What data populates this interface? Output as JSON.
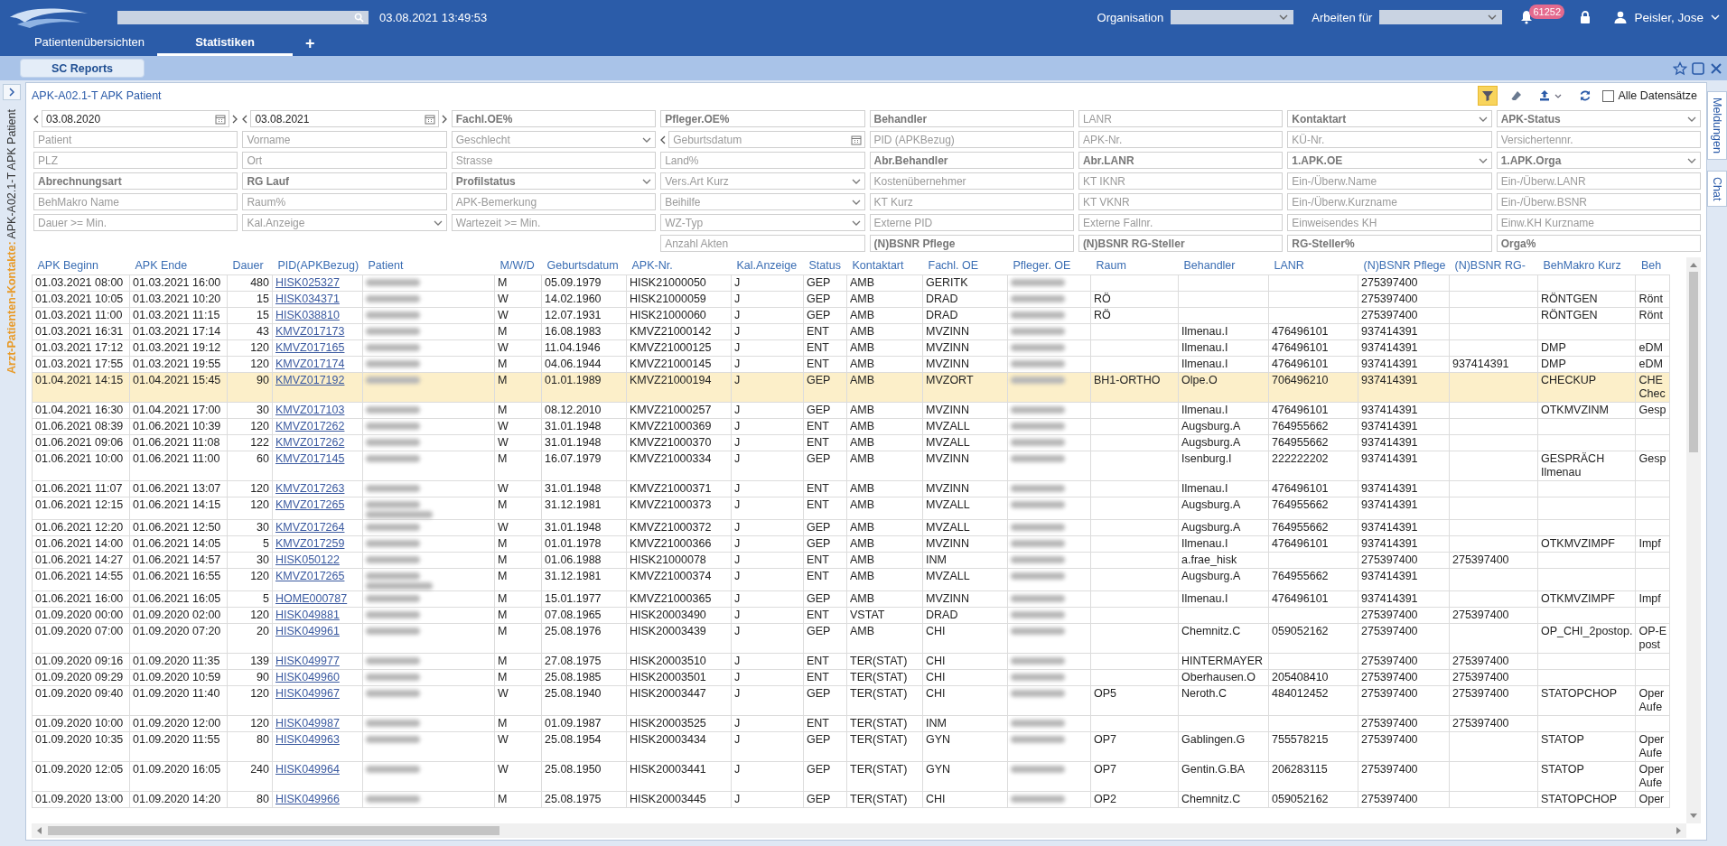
{
  "header": {
    "datetime": "03.08.2021 13:49:53",
    "organisation_label": "Organisation",
    "work_for_label": "Arbeiten für",
    "notification_count": "61252",
    "user": "Peisler, Jose"
  },
  "tabs": [
    {
      "label": "Patientenübersichten",
      "selected": false
    },
    {
      "label": "Statistiken",
      "selected": true
    }
  ],
  "add_tab": "+",
  "subbar": {
    "button": "SC Reports"
  },
  "side_label": "**Arzt-Patienten-Kontakte:** APK-A02.1-T APK Patient",
  "right_tabs": [
    "Meldungen",
    "Chat"
  ],
  "report": {
    "title": "APK-A02.1-T APK Patient",
    "toolbar": [
      {
        "kind": "filter",
        "selected": true
      },
      {
        "kind": "eraser",
        "selected": false
      },
      {
        "kind": "export",
        "selected": false
      },
      {
        "kind": "refresh",
        "selected": false
      }
    ],
    "all_records": {
      "label": "Alle Datensätze",
      "checked": false
    }
  },
  "filters": [
    [
      {
        "kind": "date",
        "value": "03.08.2020"
      },
      {
        "kind": "date",
        "value": "03.08.2021"
      },
      {
        "kind": "text",
        "placeholder": "Fachl.OE%",
        "strong": true
      },
      {
        "kind": "text",
        "placeholder": "Pfleger.OE%",
        "strong": true
      },
      {
        "kind": "text",
        "placeholder": "Behandler",
        "strong": true
      },
      {
        "kind": "text",
        "placeholder": "LANR",
        "strong": false
      },
      {
        "kind": "select",
        "placeholder": "Kontaktart",
        "strong": true
      },
      {
        "kind": "select",
        "placeholder": "APK-Status",
        "strong": true
      }
    ],
    [
      {
        "kind": "text",
        "placeholder": "Patient",
        "strong": false
      },
      {
        "kind": "text",
        "placeholder": "Vorname",
        "strong": false
      },
      {
        "kind": "select",
        "placeholder": "Geschlecht",
        "strong": false
      },
      {
        "kind": "date",
        "placeholder": "Geburtsdatum"
      },
      {
        "kind": "text",
        "placeholder": "PID (APKBezug)",
        "strong": false
      },
      {
        "kind": "text",
        "placeholder": "APK-Nr.",
        "strong": false
      },
      {
        "kind": "text",
        "placeholder": "KÜ-Nr.",
        "strong": false
      },
      {
        "kind": "text",
        "placeholder": "Versichertennr.",
        "strong": false
      }
    ],
    [
      {
        "kind": "text",
        "placeholder": "PLZ",
        "strong": false
      },
      {
        "kind": "text",
        "placeholder": "Ort",
        "strong": false
      },
      {
        "kind": "text",
        "placeholder": "Strasse",
        "strong": false
      },
      {
        "kind": "text",
        "placeholder": "Land%",
        "strong": false
      },
      {
        "kind": "text",
        "placeholder": "Abr.Behandler",
        "strong": true
      },
      {
        "kind": "text",
        "placeholder": "Abr.LANR",
        "strong": true
      },
      {
        "kind": "select",
        "placeholder": "1.APK.OE",
        "strong": true
      },
      {
        "kind": "select",
        "placeholder": "1.APK.Orga",
        "strong": true
      }
    ],
    [
      {
        "kind": "text",
        "placeholder": "Abrechnungsart",
        "strong": true
      },
      {
        "kind": "text",
        "placeholder": "RG Lauf",
        "strong": true
      },
      {
        "kind": "select",
        "placeholder": "Profilstatus",
        "strong": true
      },
      {
        "kind": "select",
        "placeholder": "Vers.Art Kurz",
        "strong": false
      },
      {
        "kind": "text",
        "placeholder": "Kostenübernehmer",
        "strong": false
      },
      {
        "kind": "text",
        "placeholder": "KT IKNR",
        "strong": false
      },
      {
        "kind": "text",
        "placeholder": "Ein-/Überw.Name",
        "strong": false
      },
      {
        "kind": "text",
        "placeholder": "Ein-/Überw.LANR",
        "strong": false
      }
    ],
    [
      {
        "kind": "text",
        "placeholder": "BehMakro Name",
        "strong": false
      },
      {
        "kind": "text",
        "placeholder": "Raum%",
        "strong": false
      },
      {
        "kind": "text",
        "placeholder": "APK-Bemerkung",
        "strong": false
      },
      {
        "kind": "select",
        "placeholder": "Beihilfe",
        "strong": false
      },
      {
        "kind": "text",
        "placeholder": "KT Kurz",
        "strong": false
      },
      {
        "kind": "text",
        "placeholder": "KT VKNR",
        "strong": false
      },
      {
        "kind": "text",
        "placeholder": "Ein-/Überw.Kurzname",
        "strong": false
      },
      {
        "kind": "text",
        "placeholder": "Ein-/Überw.BSNR",
        "strong": false
      }
    ],
    [
      {
        "kind": "text",
        "placeholder": "Dauer >= Min.",
        "strong": false
      },
      {
        "kind": "select",
        "placeholder": "Kal.Anzeige",
        "strong": false
      },
      {
        "kind": "text",
        "placeholder": "Wartezeit >= Min.",
        "strong": false
      },
      {
        "kind": "select",
        "placeholder": "WZ-Typ",
        "strong": false
      },
      {
        "kind": "text",
        "placeholder": "Externe PID",
        "strong": false
      },
      {
        "kind": "text",
        "placeholder": "Externe Fallnr.",
        "strong": false
      },
      {
        "kind": "text",
        "placeholder": "Einweisendes KH",
        "strong": false
      },
      {
        "kind": "text",
        "placeholder": "Einw.KH Kurzname",
        "strong": false
      }
    ],
    [
      {
        "kind": "text",
        "placeholder": "Anzahl Akten",
        "strong": false
      },
      {
        "kind": "text",
        "placeholder": "(N)BSNR Pflege",
        "strong": true
      },
      {
        "kind": "text",
        "placeholder": "(N)BSNR RG-Steller",
        "strong": true
      },
      {
        "kind": "text",
        "placeholder": "RG-Steller%",
        "strong": true
      },
      {
        "kind": "text",
        "placeholder": "Orga%",
        "strong": true
      }
    ]
  ],
  "table": {
    "columns": [
      {
        "label": "APK Beginn",
        "kind": "text"
      },
      {
        "label": "APK Ende",
        "kind": "text"
      },
      {
        "label": "Dauer",
        "kind": "number"
      },
      {
        "label": "PID(APKBezug)",
        "kind": "link"
      },
      {
        "label": "Patient",
        "kind": "blurred"
      },
      {
        "label": "M/W/D",
        "kind": "text"
      },
      {
        "label": "Geburtsdatum",
        "kind": "text"
      },
      {
        "label": "APK-Nr.",
        "kind": "text"
      },
      {
        "label": "Kal.Anzeige",
        "kind": "text"
      },
      {
        "label": "Status",
        "kind": "text"
      },
      {
        "label": "Kontaktart",
        "kind": "text"
      },
      {
        "label": "Fachl. OE",
        "kind": "text"
      },
      {
        "label": "Pfleger. OE",
        "kind": "blurred"
      },
      {
        "label": "Raum",
        "kind": "text"
      },
      {
        "label": "Behandler",
        "kind": "text"
      },
      {
        "label": "LANR",
        "kind": "text"
      },
      {
        "label": "(N)BSNR Pflege",
        "kind": "text"
      },
      {
        "label": "(N)BSNR RG-",
        "kind": "text"
      },
      {
        "label": "BehMakro Kurz",
        "kind": "text"
      },
      {
        "label": "Beh",
        "kind": "text"
      }
    ],
    "rows": [
      {
        "selected": false,
        "patient_wraps": false,
        "cells": [
          "01.03.2021 08:00",
          "01.03.2021 16:00",
          "480",
          "HISK025327",
          null,
          "M",
          "05.09.1979",
          "HISK21000050",
          "J",
          "GEP",
          "AMB",
          "GERITK",
          null,
          null,
          null,
          null,
          "275397400"
        ]
      },
      {
        "selected": false,
        "patient_wraps": false,
        "cells": [
          "01.03.2021 10:05",
          "01.03.2021 10:20",
          "15",
          "HISK034371",
          null,
          "W",
          "14.02.1960",
          "HISK21000059",
          "J",
          "GEP",
          "AMB",
          "DRAD",
          null,
          "RÖ",
          null,
          null,
          "275397400",
          null,
          "RÖNTGEN",
          "Rönt"
        ]
      },
      {
        "selected": false,
        "patient_wraps": false,
        "cells": [
          "01.03.2021 11:00",
          "01.03.2021 11:15",
          "15",
          "HISK038810",
          null,
          "W",
          "12.07.1931",
          "HISK21000060",
          "J",
          "GEP",
          "AMB",
          "DRAD",
          null,
          "RÖ",
          null,
          null,
          "275397400",
          null,
          "RÖNTGEN",
          "Rönt"
        ]
      },
      {
        "selected": false,
        "patient_wraps": false,
        "cells": [
          "01.03.2021 16:31",
          "01.03.2021 17:14",
          "43",
          "KMVZ017173",
          null,
          "M",
          "16.08.1983",
          "KMVZ21000142",
          "J",
          "ENT",
          "AMB",
          "MVZINN",
          null,
          null,
          "Ilmenau.I",
          "476496101",
          "937414391"
        ]
      },
      {
        "selected": false,
        "patient_wraps": false,
        "cells": [
          "01.03.2021 17:12",
          "01.03.2021 19:12",
          "120",
          "KMVZ017165",
          null,
          "W",
          "11.04.1946",
          "KMVZ21000125",
          "J",
          "ENT",
          "AMB",
          "MVZINN",
          null,
          null,
          "Ilmenau.I",
          "476496101",
          "937414391",
          null,
          "DMP",
          "eDM"
        ]
      },
      {
        "selected": false,
        "patient_wraps": false,
        "cells": [
          "01.03.2021 17:55",
          "01.03.2021 19:55",
          "120",
          "KMVZ017174",
          null,
          "M",
          "04.06.1944",
          "KMVZ21000145",
          "J",
          "ENT",
          "AMB",
          "MVZINN",
          null,
          null,
          "Ilmenau.I",
          "476496101",
          "937414391",
          "937414391",
          "DMP",
          "eDM"
        ]
      },
      {
        "selected": true,
        "patient_wraps": false,
        "cells": [
          "01.04.2021 14:15",
          "01.04.2021 15:45",
          "90",
          "KMVZ017192",
          null,
          "M",
          "01.01.1989",
          "KMVZ21000194",
          "J",
          "GEP",
          "AMB",
          "MVZORT",
          null,
          "BH1-ORTHO",
          "Olpe.O",
          "706496210",
          "937414391",
          null,
          "CHECKUP",
          "CHE\nChec"
        ]
      },
      {
        "selected": false,
        "patient_wraps": false,
        "cells": [
          "01.04.2021 16:30",
          "01.04.2021 17:00",
          "30",
          "KMVZ017103",
          null,
          "M",
          "08.12.2010",
          "KMVZ21000257",
          "J",
          "GEP",
          "AMB",
          "MVZINN",
          null,
          null,
          "Ilmenau.I",
          "476496101",
          "937414391",
          null,
          "OTKMVZINM",
          "Gesp"
        ]
      },
      {
        "selected": false,
        "patient_wraps": false,
        "cells": [
          "01.06.2021 08:39",
          "01.06.2021 10:39",
          "120",
          "KMVZ017262",
          null,
          "W",
          "31.01.1948",
          "KMVZ21000369",
          "J",
          "ENT",
          "AMB",
          "MVZALL",
          null,
          null,
          "Augsburg.A",
          "764955662",
          "937414391"
        ]
      },
      {
        "selected": false,
        "patient_wraps": false,
        "cells": [
          "01.06.2021 09:06",
          "01.06.2021 11:08",
          "122",
          "KMVZ017262",
          null,
          "W",
          "31.01.1948",
          "KMVZ21000370",
          "J",
          "ENT",
          "AMB",
          "MVZALL",
          null,
          null,
          "Augsburg.A",
          "764955662",
          "937414391"
        ]
      },
      {
        "selected": false,
        "patient_wraps": false,
        "cells": [
          "01.06.2021 10:00",
          "01.06.2021 11:00",
          "60",
          "KMVZ017145",
          null,
          "M",
          "16.07.1979",
          "KMVZ21000334",
          "J",
          "GEP",
          "AMB",
          "MVZINN",
          null,
          null,
          "Isenburg.I",
          "222222202",
          "937414391",
          null,
          "GESPRÄCH\nIlmenau",
          "Gesp"
        ]
      },
      {
        "selected": false,
        "patient_wraps": false,
        "cells": [
          "01.06.2021 11:07",
          "01.06.2021 13:07",
          "120",
          "KMVZ017263",
          null,
          "W",
          "31.01.1948",
          "KMVZ21000371",
          "J",
          "ENT",
          "AMB",
          "MVZINN",
          null,
          null,
          "Ilmenau.I",
          "476496101",
          "937414391"
        ]
      },
      {
        "selected": false,
        "patient_wraps": true,
        "cells": [
          "01.06.2021 12:15",
          "01.06.2021 14:15",
          "120",
          "KMVZ017265",
          null,
          "M",
          "31.12.1981",
          "KMVZ21000373",
          "J",
          "ENT",
          "AMB",
          "MVZALL",
          null,
          null,
          "Augsburg.A",
          "764955662",
          "937414391"
        ]
      },
      {
        "selected": false,
        "patient_wraps": false,
        "cells": [
          "01.06.2021 12:20",
          "01.06.2021 12:50",
          "30",
          "KMVZ017264",
          null,
          "W",
          "31.01.1948",
          "KMVZ21000372",
          "J",
          "GEP",
          "AMB",
          "MVZALL",
          null,
          null,
          "Augsburg.A",
          "764955662",
          "937414391"
        ]
      },
      {
        "selected": false,
        "patient_wraps": false,
        "cells": [
          "01.06.2021 14:00",
          "01.06.2021 14:05",
          "5",
          "KMVZ017259",
          null,
          "M",
          "01.01.1978",
          "KMVZ21000366",
          "J",
          "GEP",
          "AMB",
          "MVZINN",
          null,
          null,
          "Ilmenau.I",
          "476496101",
          "937414391",
          null,
          "OTKMVZIMPF",
          "Impf"
        ]
      },
      {
        "selected": false,
        "patient_wraps": false,
        "cells": [
          "01.06.2021 14:27",
          "01.06.2021 14:57",
          "30",
          "HISK050122",
          null,
          "M",
          "01.06.1988",
          "HISK21000078",
          "J",
          "ENT",
          "AMB",
          "INM",
          null,
          null,
          "a.frae_hisk",
          null,
          "275397400",
          "275397400"
        ]
      },
      {
        "selected": false,
        "patient_wraps": true,
        "cells": [
          "01.06.2021 14:55",
          "01.06.2021 16:55",
          "120",
          "KMVZ017265",
          null,
          "M",
          "31.12.1981",
          "KMVZ21000374",
          "J",
          "ENT",
          "AMB",
          "MVZALL",
          null,
          null,
          "Augsburg.A",
          "764955662",
          "937414391"
        ]
      },
      {
        "selected": false,
        "patient_wraps": false,
        "cells": [
          "01.06.2021 16:00",
          "01.06.2021 16:05",
          "5",
          "HOME000787",
          null,
          "M",
          "15.01.1977",
          "KMVZ21000365",
          "J",
          "GEP",
          "AMB",
          "MVZINN",
          null,
          null,
          "Ilmenau.I",
          "476496101",
          "937414391",
          null,
          "OTKMVZIMPF",
          "Impf"
        ]
      },
      {
        "selected": false,
        "patient_wraps": false,
        "cells": [
          "01.09.2020 00:00",
          "01.09.2020 02:00",
          "120",
          "HISK049881",
          null,
          "M",
          "07.08.1965",
          "HISK20003490",
          "J",
          "ENT",
          "VSTAT",
          "DRAD",
          null,
          null,
          null,
          null,
          "275397400",
          "275397400"
        ]
      },
      {
        "selected": false,
        "patient_wraps": false,
        "cells": [
          "01.09.2020 07:00",
          "01.09.2020 07:20",
          "20",
          "HISK049961",
          null,
          "M",
          "25.08.1976",
          "HISK20003439",
          "J",
          "GEP",
          "AMB",
          "CHI",
          null,
          null,
          "Chemnitz.C",
          "059052162",
          "275397400",
          null,
          "OP_CHI_2postop.",
          "OP-E\npost"
        ]
      },
      {
        "selected": false,
        "patient_wraps": false,
        "cells": [
          "01.09.2020 09:16",
          "01.09.2020 11:35",
          "139",
          "HISK049977",
          null,
          "M",
          "27.08.1975",
          "HISK20003510",
          "J",
          "ENT",
          "TER(STAT)",
          "CHI",
          null,
          null,
          "HINTERMAYER",
          null,
          "275397400",
          "275397400"
        ]
      },
      {
        "selected": false,
        "patient_wraps": false,
        "cells": [
          "01.09.2020 09:29",
          "01.09.2020 10:59",
          "90",
          "HISK049960",
          null,
          "M",
          "25.08.1985",
          "HISK20003501",
          "J",
          "ENT",
          "TER(STAT)",
          "CHI",
          null,
          null,
          "Oberhausen.O",
          "205408410",
          "275397400",
          "275397400"
        ]
      },
      {
        "selected": false,
        "patient_wraps": false,
        "cells": [
          "01.09.2020 09:40",
          "01.09.2020 11:40",
          "120",
          "HISK049967",
          null,
          "W",
          "25.08.1940",
          "HISK20003447",
          "J",
          "GEP",
          "TER(STAT)",
          "CHI",
          null,
          "OP5",
          "Neroth.C",
          "484012452",
          "275397400",
          "275397400",
          "STATOPCHOP",
          "Oper\nAufe"
        ]
      },
      {
        "selected": false,
        "patient_wraps": false,
        "cells": [
          "01.09.2020 10:00",
          "01.09.2020 12:00",
          "120",
          "HISK049987",
          null,
          "M",
          "01.09.1987",
          "HISK20003525",
          "J",
          "ENT",
          "TER(STAT)",
          "INM",
          null,
          null,
          null,
          null,
          "275397400",
          "275397400"
        ]
      },
      {
        "selected": false,
        "patient_wraps": false,
        "cells": [
          "01.09.2020 10:35",
          "01.09.2020 11:55",
          "80",
          "HISK049963",
          null,
          "W",
          "25.08.1954",
          "HISK20003434",
          "J",
          "GEP",
          "TER(STAT)",
          "GYN",
          null,
          "OP7",
          "Gablingen.G",
          "755578215",
          "275397400",
          null,
          "STATOP",
          "Oper\nAufe"
        ]
      },
      {
        "selected": false,
        "patient_wraps": false,
        "cells": [
          "01.09.2020 12:05",
          "01.09.2020 16:05",
          "240",
          "HISK049964",
          null,
          "W",
          "25.08.1950",
          "HISK20003441",
          "J",
          "GEP",
          "TER(STAT)",
          "GYN",
          null,
          "OP7",
          "Gentin.G.BA",
          "206283115",
          "275397400",
          null,
          "STATOP",
          "Oper\nAufe"
        ]
      },
      {
        "selected": false,
        "patient_wraps": false,
        "cells": [
          "01.09.2020 13:00",
          "01.09.2020 14:20",
          "80",
          "HISK049966",
          null,
          "M",
          "25.08.1975",
          "HISK20003445",
          "J",
          "GEP",
          "TER(STAT)",
          "CHI",
          null,
          "OP2",
          "Chemnitz.C",
          "059052162",
          "275397400",
          null,
          "STATOPCHOP",
          "Oper"
        ]
      }
    ]
  }
}
